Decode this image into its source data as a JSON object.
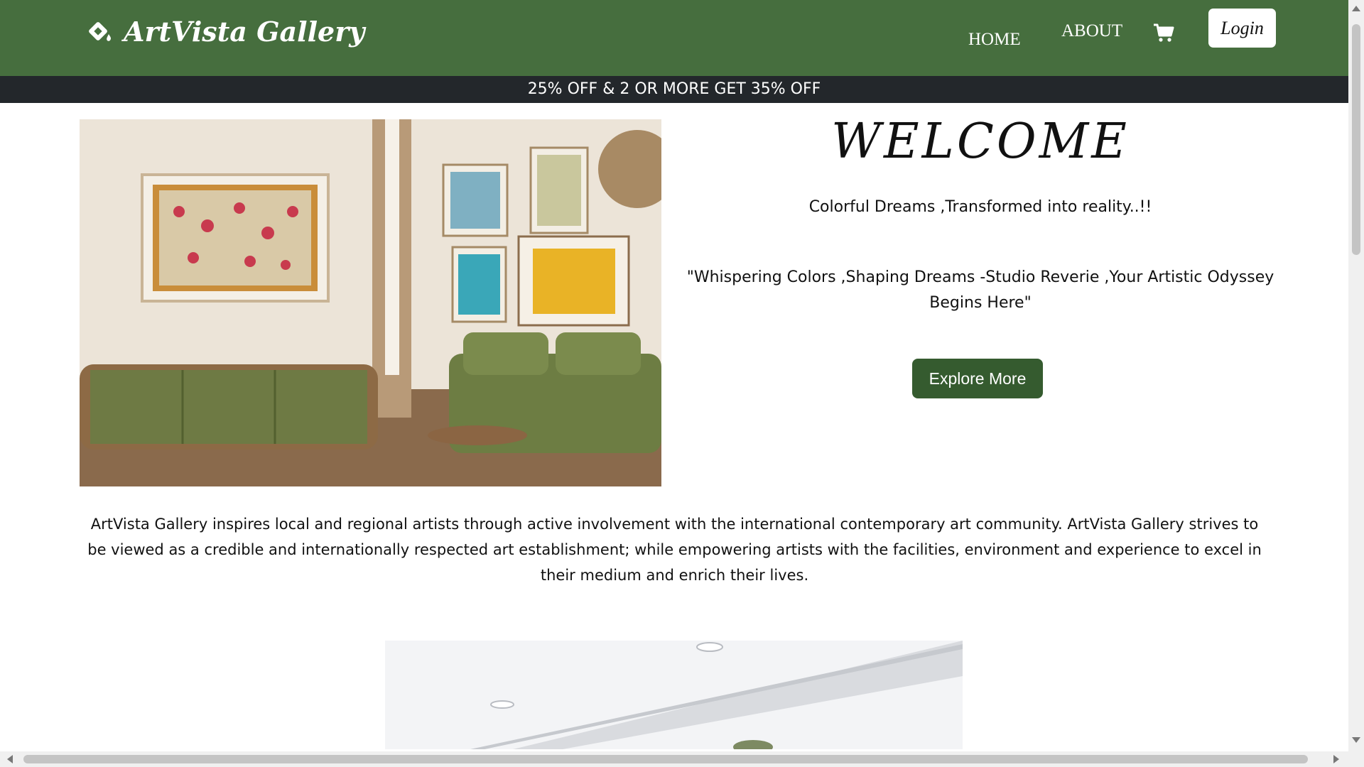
{
  "header": {
    "brand": "ArtVista Gallery",
    "nav": {
      "home": "HOME",
      "about": "ABOUT"
    },
    "login_label": "Login",
    "colors": {
      "background": "#466e3e",
      "text": "#ffffff"
    }
  },
  "promo": {
    "text": "25% OFF & 2 OR MORE GET 35% OFF",
    "background": "#23272b"
  },
  "hero": {
    "welcome": "WELCOME",
    "tagline": "Colorful Dreams ,Transformed into reality..!!",
    "quote": "\"Whispering Colors ,Shaping Dreams -Studio Reverie ,Your Artistic Odyssey Begins Here\"",
    "cta_label": "Explore More",
    "cta_color": "#355b2f"
  },
  "about": {
    "text": "ArtVista Gallery inspires local and regional artists through active involvement with the international contemporary art community. ArtVista Gallery strives to be viewed as a credible and internationally respected art establishment; while empowering artists with the facilities, environment and experience to excel in their medium and enrich their lives."
  },
  "icons": {
    "brand": "paint-bucket-icon",
    "cart": "cart-icon"
  }
}
